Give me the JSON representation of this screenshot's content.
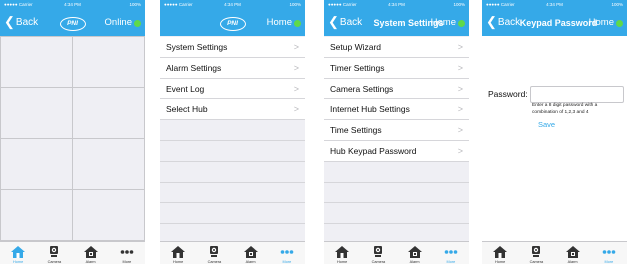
{
  "colors": {
    "brand": "#35a9e8",
    "online": "#5fd94a"
  },
  "status": {
    "carrier": "●●●●● Carrier",
    "battery": "100%",
    "time": "4:34 PM"
  },
  "screen1": {
    "back": "Back",
    "logo": "PNI",
    "right": "Online"
  },
  "screen2": {
    "logo": "PNI",
    "right": "Home",
    "items": [
      "System Settings",
      "Alarm Settings",
      "Event Log",
      "Select Hub"
    ]
  },
  "screen3": {
    "back": "Back",
    "title": "System Settings",
    "right": "Home",
    "items": [
      "Setup Wizard",
      "Timer Settings",
      "Camera Settings",
      "Internet Hub Settings",
      "Time Settings",
      "Hub Keypad Password"
    ]
  },
  "screen4": {
    "back": "Back",
    "title": "Keypad Password",
    "right": "Home",
    "password_label": "Password:",
    "password_placeholder": "",
    "hint": "Enter a 8 digit password with a combination of 1,2,3 and 4",
    "save": "Save"
  },
  "tabs": [
    {
      "label": "Home",
      "icon": "home-icon"
    },
    {
      "label": "Camera",
      "icon": "camera-icon"
    },
    {
      "label": "Alarm",
      "icon": "alarm-icon"
    },
    {
      "label": "More",
      "icon": "more-icon"
    }
  ],
  "active_tab": {
    "screen1": "Home",
    "screen2": "More",
    "screen3": "More",
    "screen4": "More"
  }
}
